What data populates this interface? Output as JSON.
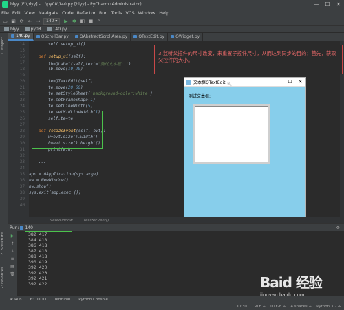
{
  "titlebar": {
    "title": "blyy [E:\\blyy] - ...\\py08\\140.py [blyy] - PyCharm (Administrator)",
    "min": "—",
    "max": "☐",
    "close": "✕"
  },
  "menu": [
    "File",
    "Edit",
    "View",
    "Navigate",
    "Code",
    "Refactor",
    "Run",
    "Tools",
    "VCS",
    "Window",
    "Help"
  ],
  "toolbar": {
    "run_config": "140 ▾"
  },
  "breadcrumbs": [
    "blyy",
    "py08",
    "140.py"
  ],
  "tabs": [
    {
      "label": "140.py",
      "active": true
    },
    {
      "label": "QScrollBar.py",
      "active": false
    },
    {
      "label": "QAbstractScrollArea.py",
      "active": false
    },
    {
      "label": "QTextEdit.py",
      "active": false
    },
    {
      "label": "QWidget.py",
      "active": false
    }
  ],
  "left_strip": {
    "project": "1: Project",
    "structure": "Z: Structure",
    "favorites": "2: Favorites"
  },
  "line_numbers": [
    "14",
    "15",
    "16",
    "17",
    "18",
    "19",
    "20",
    "21",
    "22",
    "23",
    "24",
    "25",
    "26",
    "27",
    "28",
    "29",
    "30",
    "31",
    "32",
    "33",
    "34",
    "35",
    "36",
    "37",
    "38",
    "39",
    "40"
  ],
  "code": {
    "l14": "self.setup_ui()",
    "l16a": "def ",
    "l16b": "setup_ui",
    "l16c": "(self):",
    "l17a": "lb=QLabel(self,text=",
    "l17b": "'测试文本框: '",
    "l17c": ")",
    "l18a": "lb.move(",
    "l18b": "10",
    "l18c": ",",
    "l18d": "20",
    "l18e": ")",
    "l20": "te=QTextEdit(self)",
    "l21a": "te.move(",
    "l21b": "20",
    "l21c": ",",
    "l21d": "60",
    "l21e": ")",
    "l22a": "te.setStyleSheet(",
    "l22b": "'background-color:white'",
    "l22c": ")",
    "l23a": "te.setFrameShape(",
    "l23b": "1",
    "l23c": ")",
    "l24a": "te.setLineWidth(",
    "l24b": "5",
    "l24c": ")",
    "l25a": "te.setMidLineWidth(",
    "l25b": "1",
    "l25c": ")",
    "l26": "self.te=te",
    "l28a": "def ",
    "l28b": "resizeEvent",
    "l28c": "(self, evt):",
    "l29": "w=evt.size().width()",
    "l30": "h=evt.size().height()",
    "l31": "print(w,h)",
    "l33": "...",
    "l35": "app = QApplication(sys.argv)",
    "l36": "nw = NewWindow()",
    "l37": "nw.show()",
    "l38": "sys.exit(app.exec_())"
  },
  "annotation": "3.监听父控件的尺寸改变，来重置子控件尺寸，从而达到同步的目的；首先，获取父控件的大小。",
  "qt_window": {
    "title": "文本框QTextEdit",
    "min": "—",
    "max": "☐",
    "close": "✕",
    "label": "测试文本框:"
  },
  "editor_breadcrumb": [
    "NewWindow",
    "resizeEvent()"
  ],
  "run_panel": {
    "header": "Run:",
    "config": "140",
    "output": [
      "382 417",
      "384 418",
      "386 418",
      "387 418",
      "388 418",
      "390 419",
      "392 420",
      "392 420",
      "392 421",
      "392 422"
    ]
  },
  "bottom_tabs": [
    "4: Run",
    "6: TODO",
    "Terminal",
    "Python Console"
  ],
  "statusbar": [
    "30:30",
    "CRLF ÷",
    "UTF-8 ÷",
    "4 spaces ÷",
    "Python 3.7 ÷"
  ],
  "watermark": {
    "brand": "Baid 经验",
    "url": "jingyan.baidu.com"
  },
  "colors": {
    "keyword": "#cc7832",
    "string": "#6a8759",
    "number": "#6897bb",
    "highlight": "#4cc24c",
    "annotation": "#e06666",
    "qt_bg": "#87ceeb"
  }
}
